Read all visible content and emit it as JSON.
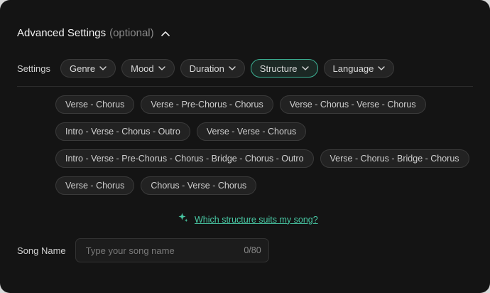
{
  "header": {
    "title": "Advanced Settings",
    "optional": "(optional)"
  },
  "settings": {
    "label": "Settings",
    "filters": [
      {
        "label": "Genre",
        "active": false
      },
      {
        "label": "Mood",
        "active": false
      },
      {
        "label": "Duration",
        "active": false
      },
      {
        "label": "Structure",
        "active": true
      },
      {
        "label": "Language",
        "active": false
      }
    ]
  },
  "structures": [
    "Verse - Chorus",
    "Verse - Pre-Chorus - Chorus",
    "Verse - Chorus - Verse - Chorus",
    "Intro - Verse - Chorus - Outro",
    "Verse - Verse - Chorus",
    "Intro - Verse - Pre-Chorus - Chorus - Bridge - Chorus - Outro",
    "Verse - Chorus - Bridge - Chorus",
    "Verse - Chorus",
    "Chorus - Verse - Chorus"
  ],
  "help": {
    "icon": "sparkle-icon",
    "link": "Which structure suits my song?"
  },
  "song_name": {
    "label": "Song Name",
    "placeholder": "Type your song name",
    "value": "",
    "counter": "0/80"
  },
  "colors": {
    "accent": "#49c9a5",
    "active_border": "#3cb093",
    "background": "#141414"
  }
}
